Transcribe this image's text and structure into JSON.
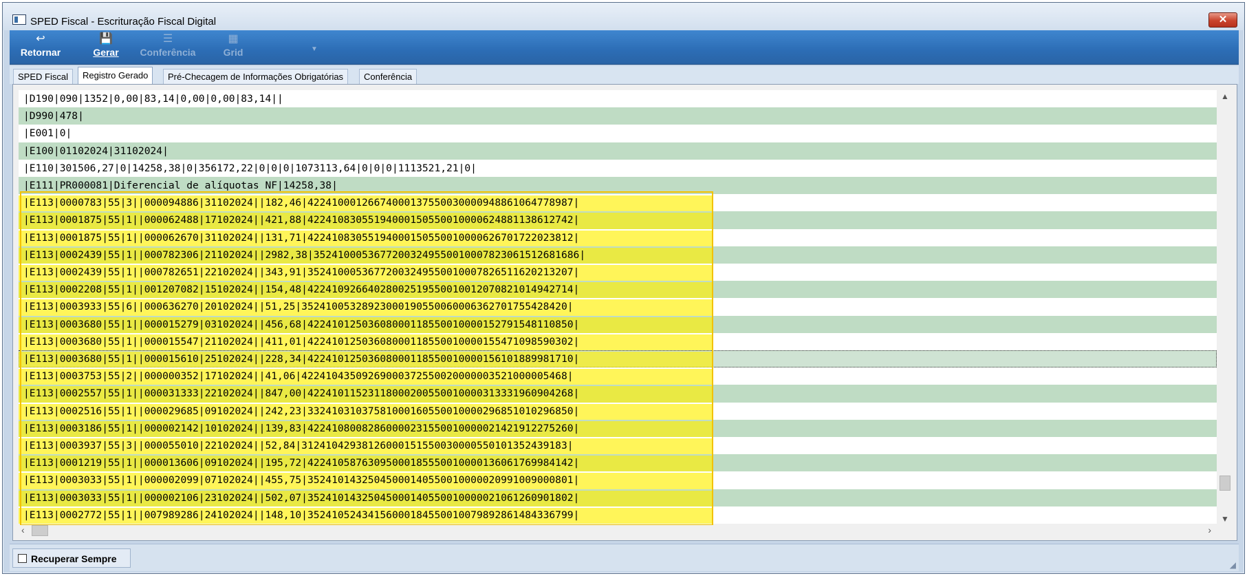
{
  "window": {
    "title": "SPED Fiscal - Escrituração Fiscal Digital",
    "close_label": "✕"
  },
  "toolbar": {
    "retornar_icon": "↩",
    "retornar_label": "Retornar",
    "gerar_icon": "💾",
    "gerar_label": "Gerar",
    "conferencia_icon": "☰",
    "conferencia_label": "Conferência",
    "grid_icon": "▦",
    "grid_label": "Grid",
    "more_icon": "▼"
  },
  "tabs": [
    {
      "label": "SPED Fiscal"
    },
    {
      "label": "Registro Gerado"
    },
    {
      "label": "Pré-Checagem de Informações Obrigatórias"
    },
    {
      "label": "Conferência"
    }
  ],
  "lines": [
    "|D190|090|1352|0,00|83,14|0,00|0,00|83,14||",
    "|D990|478|",
    "|E001|0|",
    "|E100|01102024|31102024|",
    "|E110|301506,27|0|14258,38|0|356172,22|0|0|0|1073113,64|0|0|0|1113521,21|0|",
    "|E111|PR000081|Diferencial de alíquotas NF|14258,38|",
    "|E113|0000783|55|3||000094886|31102024||182,46|42241000126674000137550030000948861064778987|",
    "|E113|0001875|55|1||000062488|17102024||421,88|42241083055194000150550010000624881138612742|",
    "|E113|0001875|55|1||000062670|31102024||131,71|42241083055194000150550010000626701722023812|",
    "|E113|0002439|55|1||000782306|21102024||2982,38|35241000536772003249550010007823061512681686|",
    "|E113|0002439|55|1||000782651|22102024||343,91|35241000536772003249550010007826511620213207|",
    "|E113|0002208|55|1||001207082|15102024||154,48|42241092664028002519550010012070821014942714|",
    "|E113|0003933|55|6||000636270|20102024||51,25|35241005328923000190550060006362701755428420|",
    "|E113|0003680|55|1||000015279|03102024||456,68|42241012503608000118550010000152791548110850|",
    "|E113|0003680|55|1||000015547|21102024||411,01|42241012503608000118550010000155471098590302|",
    "|E113|0003680|55|1||000015610|25102024||228,34|42241012503608000118550010000156101889981710|",
    "|E113|0003753|55|2||000000352|17102024||41,06|42241043509269000372550020000003521000005468|",
    "|E113|0002557|55|1||000031333|22102024||847,00|42241011523118000200550010000313331960904268|",
    "|E113|0002516|55|1||000029685|09102024||242,23|33241031037581000160550010000296851010296850|",
    "|E113|0003186|55|1||000002142|10102024||139,83|42241080082860000231550010000021421912275260|",
    "|E113|0003937|55|3||000055010|22102024||52,84|31241042938126000151550030000550101352439183|",
    "|E113|0001219|55|1||000013606|09102024||195,72|42241058763095000185550010000136061769984142|",
    "|E113|0003033|55|1||000002099|07102024||455,75|35241014325045000140550010000020991009000801|",
    "|E113|0003033|55|1||000002106|23102024||502,07|35241014325045000140550010000021061260901802|",
    "|E113|0002772|55|1||007989286|24102024||148,10|35241052434156000184550010079892861484336799|"
  ],
  "status": {
    "recuperar_label": "Recuperar Sempre",
    "recuperar_checked": false
  }
}
